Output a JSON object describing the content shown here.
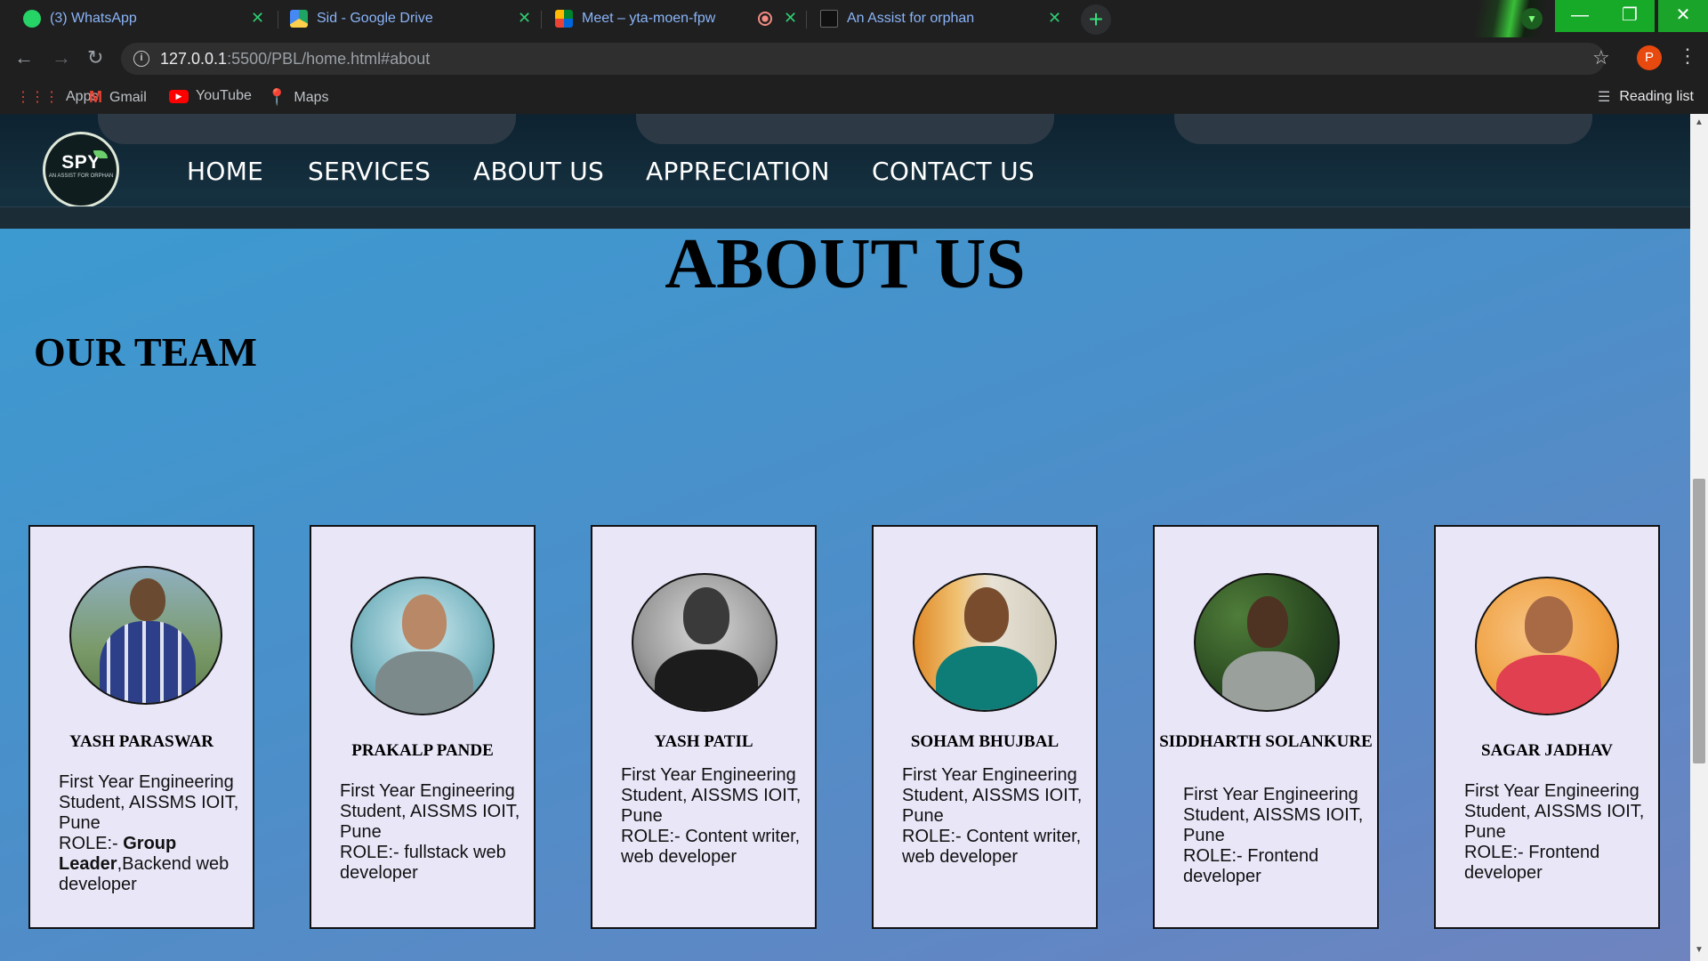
{
  "browser": {
    "tabs": [
      {
        "title": "(3) WhatsApp",
        "icon": "whatsapp-icon"
      },
      {
        "title": "Sid - Google Drive",
        "icon": "google-drive-icon"
      },
      {
        "title": "Meet – yta-moen-fpw",
        "icon": "google-meet-icon"
      },
      {
        "title": "An Assist for orphan",
        "icon": "spy-site-icon"
      }
    ],
    "url_host": "127.0.0.1",
    "url_path": ":5500/PBL/home.html#about",
    "profile_initial": "P",
    "bookmarks": [
      {
        "label": "Apps",
        "icon": "apps-grid-icon"
      },
      {
        "label": "Gmail",
        "icon": "gmail-icon"
      },
      {
        "label": "YouTube",
        "icon": "youtube-icon"
      },
      {
        "label": "Maps",
        "icon": "maps-pin-icon"
      }
    ],
    "reading_list": "Reading list"
  },
  "site": {
    "logo_text": "SPY",
    "logo_sub": "AN ASSIST FOR ORPHAN",
    "menu": [
      "HOME",
      "SERVICES",
      "ABOUT US",
      "APPRECIATION",
      "CONTACT US"
    ],
    "heading": "ABOUT US",
    "subheading": "OUR TEAM"
  },
  "team": [
    {
      "name": "YASH PARASWAR",
      "line1": "First Year Engineering Student, AISSMS IOIT, Pune",
      "role_prefix": "ROLE:- ",
      "role_bold": "Group Leader",
      "role_rest": ",Backend web developer"
    },
    {
      "name": "PRAKALP PANDE",
      "line1": "First Year Engineering Student, AISSMS IOIT, Pune",
      "role_prefix": "ROLE:- fullstack web developer",
      "role_bold": "",
      "role_rest": ""
    },
    {
      "name": "YASH PATIL",
      "line1": "First Year Engineering Student, AISSMS IOIT, Pune",
      "role_prefix": "ROLE:- Content writer, web developer",
      "role_bold": "",
      "role_rest": ""
    },
    {
      "name": "SOHAM BHUJBAL",
      "line1": "First Year Engineering Student, AISSMS IOIT, Pune",
      "role_prefix": "ROLE:- Content writer, web developer",
      "role_bold": "",
      "role_rest": ""
    },
    {
      "name": "SIDDHARTH SOLANKURE",
      "line1": "First Year Engineering Student, AISSMS IOIT, Pune",
      "role_prefix": "ROLE:- Frontend developer",
      "role_bold": "",
      "role_rest": ""
    },
    {
      "name": "SAGAR JADHAV",
      "line1": "First Year Engineering Student, AISSMS IOIT, Pune",
      "role_prefix": "ROLE:- Frontend developer",
      "role_bold": "",
      "role_rest": ""
    }
  ],
  "colors": {
    "tab_text": "#8ab4f8",
    "tab_close": "#2ecc71",
    "window_controls": "#17a928",
    "card_bg": "#e9e6f8",
    "section_bg": "#4b8fc9"
  }
}
